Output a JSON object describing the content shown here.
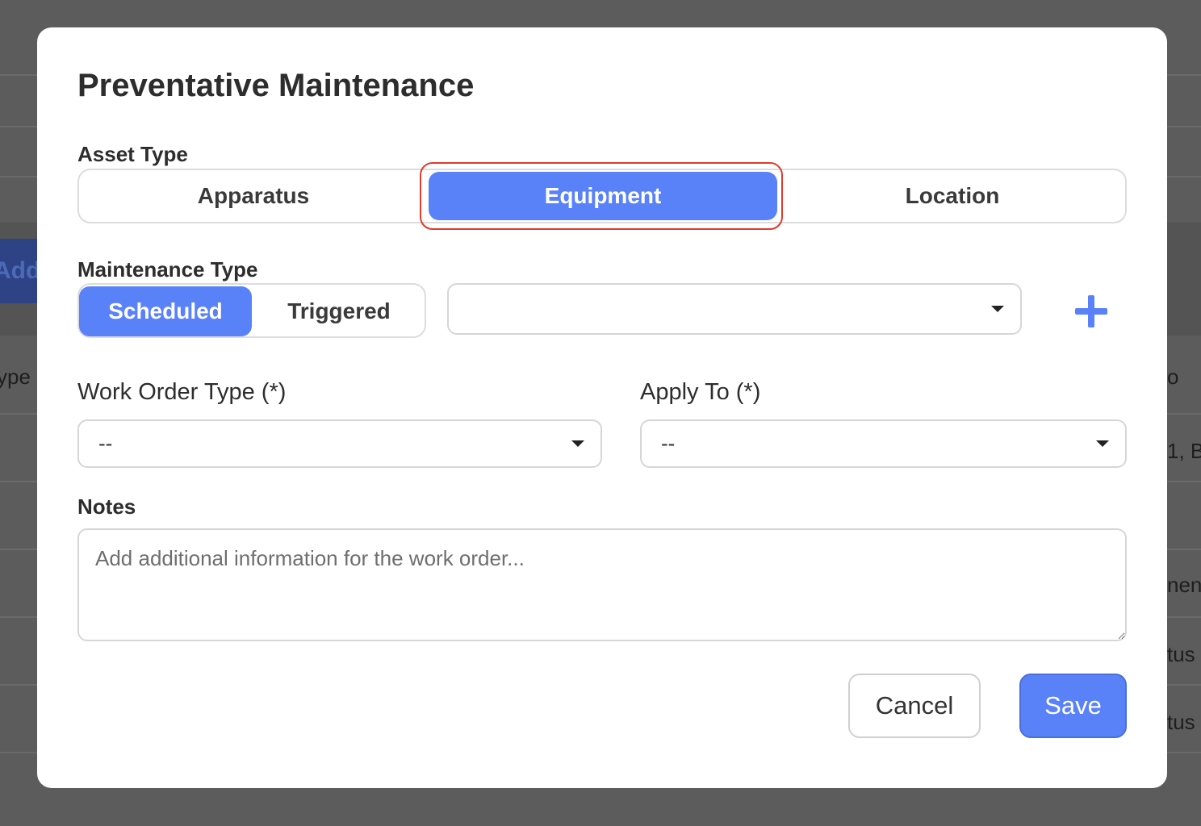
{
  "background": {
    "add_button_fragment": "Add M",
    "right_fragments": [
      "o",
      "1, B",
      "nen",
      "tus",
      "tus"
    ],
    "left_fragment": "ype"
  },
  "modal": {
    "title": "Preventative Maintenance",
    "asset_type": {
      "label": "Asset Type",
      "options": [
        "Apparatus",
        "Equipment",
        "Location"
      ],
      "selected": "Equipment"
    },
    "maintenance_type": {
      "label": "Maintenance Type",
      "options": [
        "Scheduled",
        "Triggered"
      ],
      "selected": "Scheduled",
      "dropdown_value": "",
      "add_icon": "plus-icon"
    },
    "work_order_type": {
      "label": "Work Order Type (*)",
      "value": "--"
    },
    "apply_to": {
      "label": "Apply To (*)",
      "value": "--"
    },
    "notes": {
      "label": "Notes",
      "placeholder": "Add additional information for the work order..."
    },
    "buttons": {
      "cancel": "Cancel",
      "save": "Save"
    }
  },
  "colors": {
    "accent": "#5a82f8",
    "highlight_ring": "#dd3b2b",
    "overlay": "#5c5c5c"
  }
}
